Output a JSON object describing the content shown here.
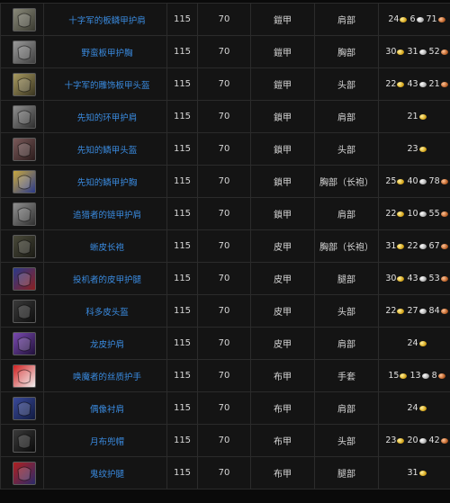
{
  "colors": {
    "link": "#3a8be0",
    "gold": "#d8a920",
    "silver": "#b4b4b4",
    "copper": "#c0652b",
    "background": "#141414",
    "border": "#2b2b2b"
  },
  "rows": [
    {
      "icon": "helmet-shoulder-icon",
      "name": "十字军的板鳞甲护肩",
      "level": "115",
      "req": "70",
      "type": "鎧甲",
      "slot": "肩部",
      "gold": "24",
      "silver": "6",
      "copper": "71",
      "palette": [
        "#8a8a7a",
        "#3a3a30"
      ]
    },
    {
      "icon": "chest-armor-icon",
      "name": "野蛮板甲护胸",
      "level": "115",
      "req": "70",
      "type": "鎧甲",
      "slot": "胸部",
      "gold": "30",
      "silver": "31",
      "copper": "52",
      "palette": [
        "#9a9a9a",
        "#404040"
      ]
    },
    {
      "icon": "plate-helm-icon",
      "name": "十字军的雕饰板甲头盔",
      "level": "115",
      "req": "70",
      "type": "鎧甲",
      "slot": "头部",
      "gold": "22",
      "silver": "43",
      "copper": "21",
      "palette": [
        "#a89a60",
        "#3a3520"
      ]
    },
    {
      "icon": "mail-shoulder-icon",
      "name": "先知的环甲护肩",
      "level": "115",
      "req": "70",
      "type": "鎖甲",
      "slot": "肩部",
      "gold": "21",
      "silver": "",
      "copper": "",
      "palette": [
        "#8e8e8e",
        "#2e2e2e"
      ]
    },
    {
      "icon": "mail-helm-icon",
      "name": "先知的鳞甲头盔",
      "level": "115",
      "req": "70",
      "type": "鎖甲",
      "slot": "头部",
      "gold": "23",
      "silver": "",
      "copper": "",
      "palette": [
        "#7a5a5a",
        "#2a1a1a"
      ]
    },
    {
      "icon": "mail-chest-icon",
      "name": "先知的鳞甲护胸",
      "level": "115",
      "req": "70",
      "type": "鎖甲",
      "slot": "胸部（长袍）",
      "gold": "25",
      "silver": "40",
      "copper": "78",
      "palette": [
        "#c8a840",
        "#2a3a8a"
      ]
    },
    {
      "icon": "mail-shoulder-icon",
      "name": "追猎者的链甲护肩",
      "level": "115",
      "req": "70",
      "type": "鎖甲",
      "slot": "肩部",
      "gold": "22",
      "silver": "10",
      "copper": "55",
      "palette": [
        "#909090",
        "#303030"
      ]
    },
    {
      "icon": "leather-robe-icon",
      "name": "蜥皮长袍",
      "level": "115",
      "req": "70",
      "type": "皮甲",
      "slot": "胸部（长袍）",
      "gold": "31",
      "silver": "22",
      "copper": "67",
      "palette": [
        "#4a4a3a",
        "#1a1a14"
      ]
    },
    {
      "icon": "leather-legs-icon",
      "name": "投机者的皮甲护腿",
      "level": "115",
      "req": "70",
      "type": "皮甲",
      "slot": "腿部",
      "gold": "30",
      "silver": "43",
      "copper": "53",
      "palette": [
        "#2a3a8a",
        "#8a2020"
      ]
    },
    {
      "icon": "leather-hood-icon",
      "name": "科多皮头盔",
      "level": "115",
      "req": "70",
      "type": "皮甲",
      "slot": "头部",
      "gold": "22",
      "silver": "27",
      "copper": "84",
      "palette": [
        "#3a3a3a",
        "#0e0e0e"
      ]
    },
    {
      "icon": "dragonhide-shoulder-icon",
      "name": "龙皮护肩",
      "level": "115",
      "req": "70",
      "type": "皮甲",
      "slot": "肩部",
      "gold": "24",
      "silver": "",
      "copper": "",
      "palette": [
        "#7a4ab0",
        "#20103a"
      ]
    },
    {
      "icon": "cloth-gloves-icon",
      "name": "唤魔者的丝质护手",
      "level": "115",
      "req": "70",
      "type": "布甲",
      "slot": "手套",
      "gold": "15",
      "silver": "13",
      "copper": "8",
      "palette": [
        "#d02020",
        "#f0f0f0"
      ]
    },
    {
      "icon": "cloth-shoulder-icon",
      "name": "偶像衬肩",
      "level": "115",
      "req": "70",
      "type": "布甲",
      "slot": "肩部",
      "gold": "24",
      "silver": "",
      "copper": "",
      "palette": [
        "#3a4a9a",
        "#101a40"
      ]
    },
    {
      "icon": "cloth-hood-icon",
      "name": "月布兜帽",
      "level": "115",
      "req": "70",
      "type": "布甲",
      "slot": "头部",
      "gold": "23",
      "silver": "20",
      "copper": "42",
      "palette": [
        "#3a3a3a",
        "#0a0a0a"
      ]
    },
    {
      "icon": "cloth-legs-icon",
      "name": "鬼纹护腿",
      "level": "115",
      "req": "70",
      "type": "布甲",
      "slot": "腿部",
      "gold": "31",
      "silver": "",
      "copper": "",
      "palette": [
        "#b02020",
        "#2a2a6a"
      ]
    }
  ]
}
